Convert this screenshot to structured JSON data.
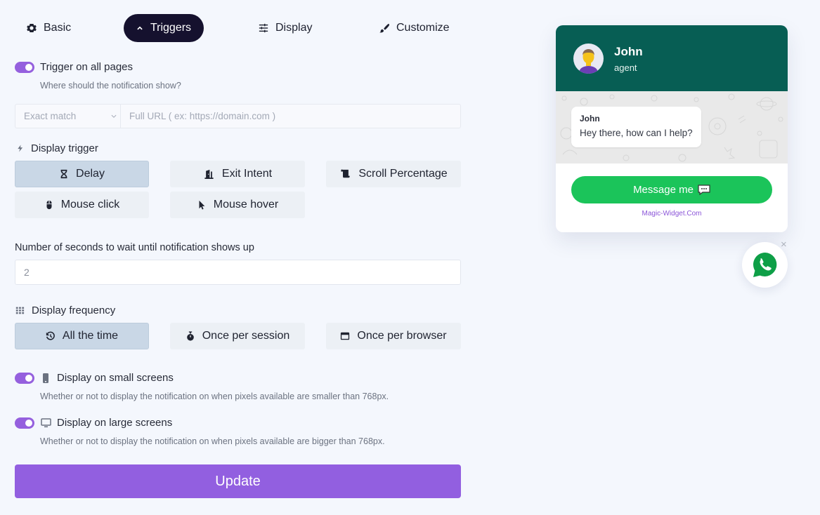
{
  "tabs": [
    {
      "label": "Basic",
      "icon": "gear-icon",
      "active": false
    },
    {
      "label": "Triggers",
      "icon": "chevron-up-icon",
      "active": true
    },
    {
      "label": "Display",
      "icon": "sliders-icon",
      "active": false
    },
    {
      "label": "Customize",
      "icon": "paintbrush-icon",
      "active": false
    }
  ],
  "trigger_all_pages": {
    "label": "Trigger on all pages",
    "help": "Where should the notification show?",
    "enabled": true
  },
  "url_match": {
    "select_value": "Exact match",
    "input_placeholder": "Full URL ( ex: https://domain.com )",
    "input_value": ""
  },
  "display_trigger": {
    "label": "Display trigger",
    "options": [
      {
        "label": "Delay",
        "icon": "hourglass-icon",
        "selected": true
      },
      {
        "label": "Exit Intent",
        "icon": "door-exit-icon",
        "selected": false
      },
      {
        "label": "Scroll Percentage",
        "icon": "scroll-icon",
        "selected": false
      },
      {
        "label": "Mouse click",
        "icon": "mouse-icon",
        "selected": false
      },
      {
        "label": "Mouse hover",
        "icon": "pointer-icon",
        "selected": false
      }
    ]
  },
  "delay_seconds": {
    "label": "Number of seconds to wait until notification shows up",
    "value": "2"
  },
  "display_frequency": {
    "label": "Display frequency",
    "options": [
      {
        "label": "All the time",
        "icon": "history-icon",
        "selected": true
      },
      {
        "label": "Once per session",
        "icon": "stopwatch-icon",
        "selected": false
      },
      {
        "label": "Once per browser",
        "icon": "window-icon",
        "selected": false
      }
    ]
  },
  "small_screens": {
    "label": "Display on small screens",
    "help": "Whether or not to display the notification on when pixels available are smaller than 768px.",
    "enabled": true
  },
  "large_screens": {
    "label": "Display on large screens",
    "help": "Whether or not to display the notification on when pixels available are bigger than 768px.",
    "enabled": true
  },
  "update_label": "Update",
  "widget": {
    "agent_name": "John",
    "agent_role": "agent",
    "bubble_name": "John",
    "bubble_text": "Hey there, how can I help?",
    "button_label": "Message me",
    "brand": "Magic-Widget.Com",
    "header_color": "#075e54",
    "button_color": "#1bc45a",
    "close_label": "×"
  },
  "colors": {
    "accent": "#925fe0",
    "tab_active": "#15112e",
    "option_selected": "#c9d7e6",
    "option_default": "#ecf0f5"
  }
}
